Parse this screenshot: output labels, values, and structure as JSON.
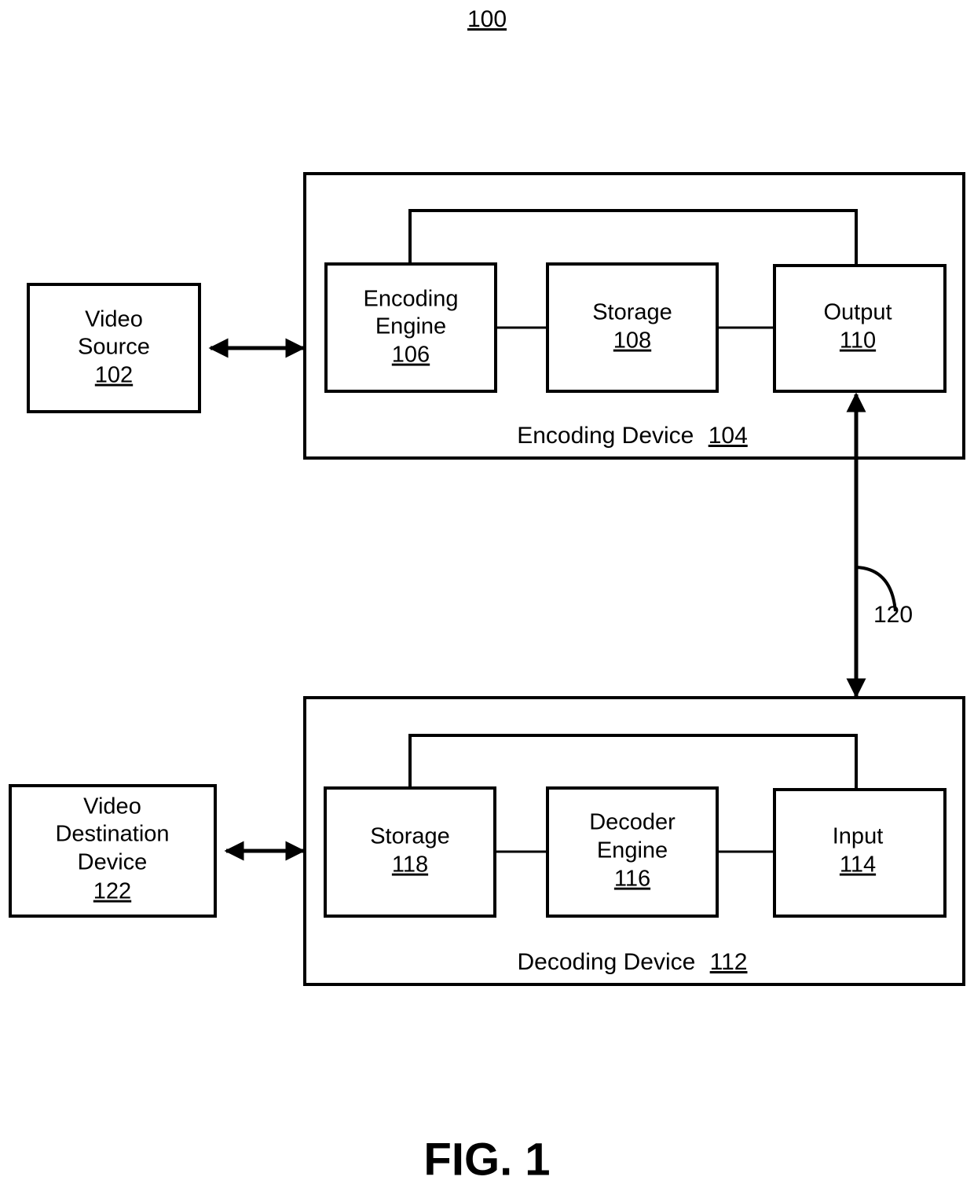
{
  "figure": {
    "number_label": "100",
    "caption": "FIG. 1"
  },
  "nodes": {
    "video_source": {
      "line1": "Video",
      "line2": "Source",
      "ref": "102"
    },
    "encoding_device": {
      "label": "Encoding Device",
      "ref": "104"
    },
    "encoding_engine": {
      "line1": "Encoding",
      "line2": "Engine",
      "ref": "106"
    },
    "encoder_storage": {
      "line1": "Storage",
      "ref": "108"
    },
    "output": {
      "line1": "Output",
      "ref": "110"
    },
    "decoding_device": {
      "label": "Decoding Device",
      "ref": "112"
    },
    "decoder_storage": {
      "line1": "Storage",
      "ref": "118"
    },
    "decoder_engine": {
      "line1": "Decoder",
      "line2": "Engine",
      "ref": "116"
    },
    "input": {
      "line1": "Input",
      "ref": "114"
    },
    "video_destination_device": {
      "line1": "Video",
      "line2": "Destination",
      "line3": "Device",
      "ref": "122"
    }
  },
  "connections": {
    "link_120": {
      "label": "120"
    }
  },
  "colors": {
    "stroke": "#000000",
    "fill": "#ffffff",
    "text": "#000000"
  }
}
